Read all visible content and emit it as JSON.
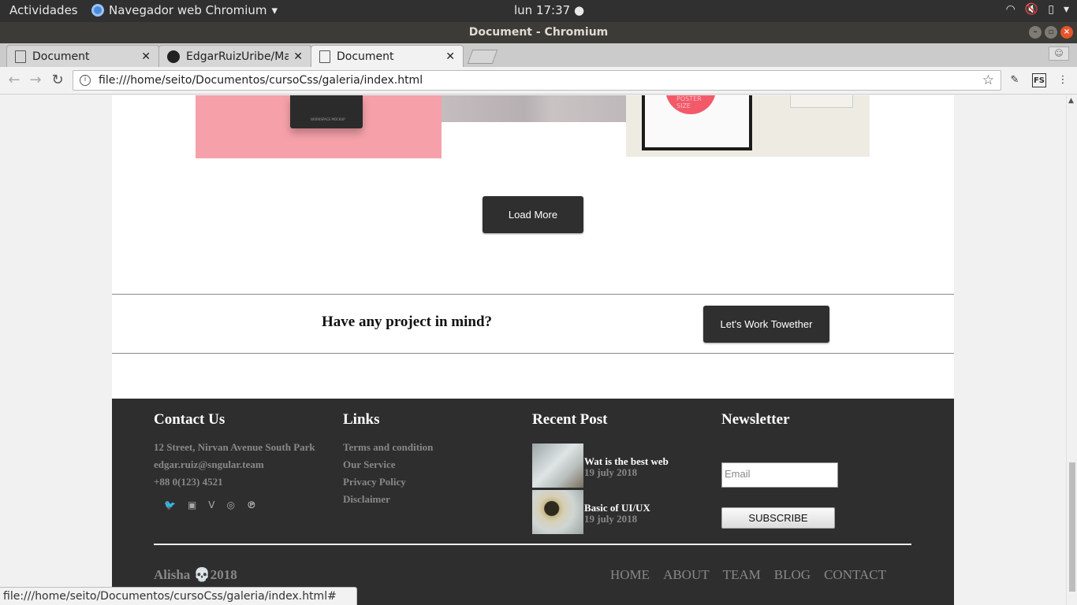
{
  "os": {
    "activities": "Actividades",
    "app_name": "Navegador web Chromium",
    "clock": "lun 17:37"
  },
  "window": {
    "title": "Document - Chromium"
  },
  "tabs": [
    {
      "label": "Document",
      "icon": "document-icon",
      "active": false
    },
    {
      "label": "EdgarRuizUribe/Ma",
      "icon": "github-icon",
      "active": false
    },
    {
      "label": "Document",
      "icon": "document-icon",
      "active": true
    }
  ],
  "address_bar": {
    "url": "file:///home/seito/Documentos/cursoCss/galeria/index.html"
  },
  "page": {
    "gallery_text": {
      "box_label": "WORKSPACE MOCKUP",
      "poster_label": "POSTER SIZE"
    },
    "load_more": "Load More",
    "cta": {
      "title": "Have any project in mind?",
      "button": "Let's Work Towether"
    },
    "footer": {
      "contact": {
        "title": "Contact Us",
        "address": "12 Street, Nirvan Avenue South Park",
        "email": "edgar.ruiz@sngular.team",
        "phone": "+88 0(123) 4521",
        "social": [
          "twitter-icon",
          "facebook-icon",
          "vine-icon",
          "instagram-icon",
          "pinterest-icon"
        ]
      },
      "links": {
        "title": "Links",
        "items": [
          "Terms and condition",
          "Our Service",
          "Privacy Policy",
          "Disclaimer"
        ]
      },
      "recent": {
        "title": "Recent Post",
        "posts": [
          {
            "title": "Wat is the best web",
            "date": "19 july 2018"
          },
          {
            "title": "Basic of UI/UX",
            "date": "19 july 2018"
          }
        ]
      },
      "newsletter": {
        "title": "Newsletter",
        "email_placeholder": "Email",
        "subscribe": "SUBSCRIBE"
      },
      "brand": "Alisha 💀2018",
      "nav": [
        "HOME",
        "ABOUT",
        "TEAM",
        "BLOG",
        "CONTACT"
      ]
    }
  },
  "status_bar": "file:///home/seito/Documentos/cursoCss/galeria/index.html#"
}
